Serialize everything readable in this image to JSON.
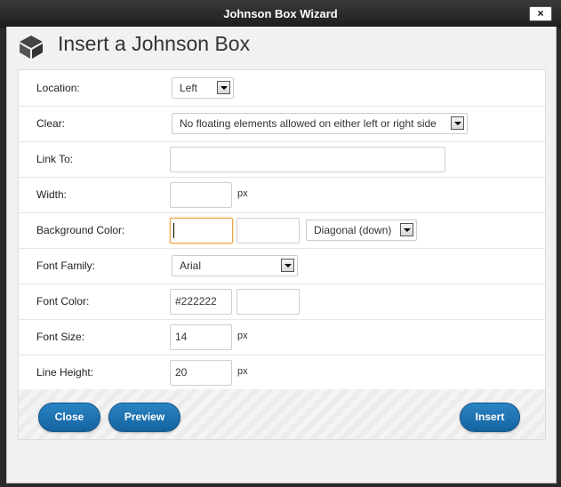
{
  "window": {
    "title": "Johnson Box Wizard",
    "close_label": "×"
  },
  "header": {
    "title": "Insert a Johnson Box",
    "icon": "box-icon"
  },
  "fields": {
    "location": {
      "label": "Location:",
      "value": "Left"
    },
    "clear": {
      "label": "Clear:",
      "value": "No floating elements allowed on either left or right side"
    },
    "link_to": {
      "label": "Link To:",
      "value": ""
    },
    "width": {
      "label": "Width:",
      "value": "",
      "unit": "px"
    },
    "background_color": {
      "label": "Background Color:",
      "color1": "",
      "color2": "",
      "gradient": "Diagonal (down)"
    },
    "font_family": {
      "label": "Font Family:",
      "value": "Arial"
    },
    "font_color": {
      "label": "Font Color:",
      "value": "#222222",
      "value2": ""
    },
    "font_size": {
      "label": "Font Size:",
      "value": "14",
      "unit": "px"
    },
    "line_height": {
      "label": "Line Height:",
      "value": "20",
      "unit": "px"
    }
  },
  "buttons": {
    "close": "Close",
    "preview": "Preview",
    "insert": "Insert"
  },
  "colors": {
    "button": "#1b6fae",
    "focus_border": "#e5a54a",
    "titlebar": "#2a2a2a"
  }
}
